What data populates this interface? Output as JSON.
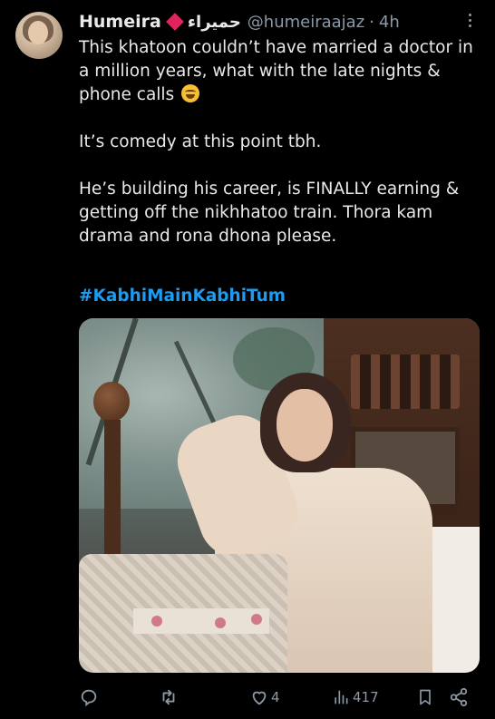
{
  "tweet": {
    "display_name": "Humeira",
    "urdu_name": "حمیراء",
    "handle": "@humeiraajaz",
    "separator": "·",
    "time": "4h",
    "lines": {
      "l1": "This khatoon couldn’t have married a doctor in",
      "l2": "a million years, what with the late nights &",
      "l3": "phone calls",
      "l4": "It’s comedy at this point tbh.",
      "l5": "He’s building his career, is FINALLY earning &",
      "l6": "getting off the nikhhatoo train. Thora kam",
      "l7": "drama and rona dhona please."
    },
    "hashtag": "#KabhiMainKabhiTum",
    "emoji": "laughing-face",
    "accent_color": "#1d9bf0",
    "badge_color": "#e0245e"
  },
  "actions": {
    "reply_icon": "reply-icon",
    "retweet_icon": "retweet-icon",
    "like_icon": "heart-icon",
    "like_count": "4",
    "views_icon": "views-icon",
    "views_count": "417",
    "bookmark_icon": "bookmark-icon",
    "share_icon": "share-icon"
  }
}
